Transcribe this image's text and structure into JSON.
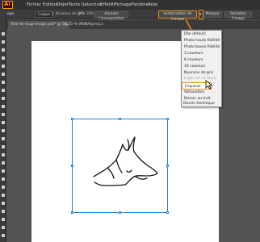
{
  "app": {
    "logo_text": "Ai"
  },
  "menubar": {
    "items": [
      "Fichier",
      "Edition",
      "Objet",
      "Texte",
      "Sélection",
      "Effet",
      "Affichage",
      "Fenêtre",
      "Aide"
    ]
  },
  "control_bar": {
    "object_type": "Image",
    "colorspace": "Calque 1",
    "bitmap_info": "Niveaux de gris",
    "ppi": "PPI: 300",
    "unlink_label": "Annuler l'incorporation",
    "trace_button_label": "Vectorisation de l'image",
    "mask_label": "Masque",
    "crop_label": "Recadrer l'image"
  },
  "document": {
    "tab_title": "Tete-de-loup-image.psd* @ 56,25 % (RVB/Aperçu)",
    "close_glyph": "×"
  },
  "trace_presets": {
    "items": [
      "[Par défaut]",
      "Photo haute fidélité",
      "Photo basse fidélité",
      "3 couleurs",
      "6 couleurs",
      "16 couleurs",
      "Nuances de gris",
      "Logo noir et blanc",
      "Esquisse",
      "Silhouettes",
      "Dessin au trait",
      "Dessin technique"
    ],
    "highlighted": "Esquisse"
  },
  "colors": {
    "accent": "#f08c1c",
    "selection": "#1e82d2",
    "ui_dark": "#323232",
    "pasteboard": "#535353"
  },
  "icons": [
    "menu-logo",
    "cursor-arrow-icon",
    "dropdown-chevron-icon"
  ]
}
